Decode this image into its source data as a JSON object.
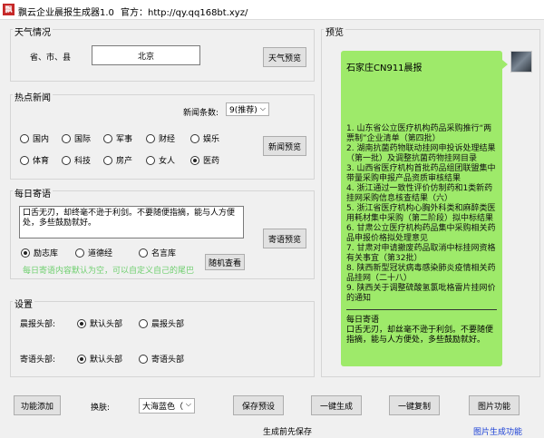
{
  "window": {
    "title": "飘云企业晨报生成器1.0",
    "site_label": "官方：http://qy.qq168bt.xyz/"
  },
  "weather": {
    "group_title": "天气情况",
    "location_label": "省、市、县",
    "location_value": "北京",
    "preview_button": "天气预览"
  },
  "news": {
    "group_title": "热点新闻",
    "count_label": "新闻条数:",
    "count_value": "9(推荐)",
    "categories": [
      {
        "label": "国内",
        "checked": false
      },
      {
        "label": "国际",
        "checked": false
      },
      {
        "label": "军事",
        "checked": false
      },
      {
        "label": "财经",
        "checked": false
      },
      {
        "label": "娱乐",
        "checked": false
      },
      {
        "label": "体育",
        "checked": false
      },
      {
        "label": "科技",
        "checked": false
      },
      {
        "label": "房产",
        "checked": false
      },
      {
        "label": "女人",
        "checked": false
      },
      {
        "label": "医药",
        "checked": true
      }
    ],
    "preview_button": "新闻预览"
  },
  "greeting": {
    "group_title": "每日寄语",
    "text": "口舌无刃，却终毫不逊于利剑。不要随便指摘，能与人方便处，多些鼓励就好。",
    "sources": [
      {
        "label": "励志库",
        "checked": true
      },
      {
        "label": "道德经",
        "checked": false
      },
      {
        "label": "名言库",
        "checked": false
      }
    ],
    "hint": "每日寄语内容默认为空，可以自定义自己的尾巴",
    "preview_button": "寄语预览",
    "random_button": "随机查看"
  },
  "settings": {
    "group_title": "设置",
    "report_head_label": "晨报头部:",
    "report_head_options": [
      {
        "label": "默认头部",
        "checked": true
      },
      {
        "label": "晨报头部",
        "checked": false
      }
    ],
    "greet_head_label": "寄语头部:",
    "greet_head_options": [
      {
        "label": "默认头部",
        "checked": true
      },
      {
        "label": "寄语头部",
        "checked": false
      }
    ]
  },
  "preview": {
    "group_title": "预览",
    "title": "石家庄CN911晨报",
    "items": [
      "1. 山东省公立医疗机构药品采购推行“两票制”企业清单（第四批）",
      "2. 湖南抗菌药物联动挂网申投诉处理结果（第一批）及调整抗菌药物挂网目录",
      "3. 山西省医疗机构首批药品组团联盟集中带量采购申报产品资质审核结果",
      "4. 浙江通过一致性评价仿制药和1类新药挂网采购信息核查结果（六）",
      "5. 浙江省医疗机构心胸外科类和麻醉类医用耗材集中采购（第二阶段）拟中标结果",
      "6. 甘肃公立医疗机构药品集中采购相关药品申报价格拟处理意见",
      "7. 甘肃对申请撤废药品取消中标挂网资格有关事宜（第32批）",
      "8. 陕西新型冠状病毒感染肺炎疫情相关药品挂网（二十八）",
      "9. 陕西关于调整硫酸氢氯吡格雷片挂网价的通知"
    ],
    "greet_label": "每日寄语",
    "greet_text": "口舌无刃，却丝毫不逊于利剑。不要随便指摘，能与人方便处，多些鼓励就好。"
  },
  "bottom": {
    "add_button": "功能添加",
    "skin_label": "换肤:",
    "skin_value": "大海蓝色（",
    "save_button": "保存预设",
    "generate_button": "一键生成",
    "copy_button": "一键复制",
    "image_button": "图片功能",
    "status_text": "生成前先保存",
    "image_status": "图片生成功能"
  },
  "colors": {
    "bubble": "#9eea6a",
    "hint": "#6fcf6f",
    "link": "#1a3fd6"
  }
}
